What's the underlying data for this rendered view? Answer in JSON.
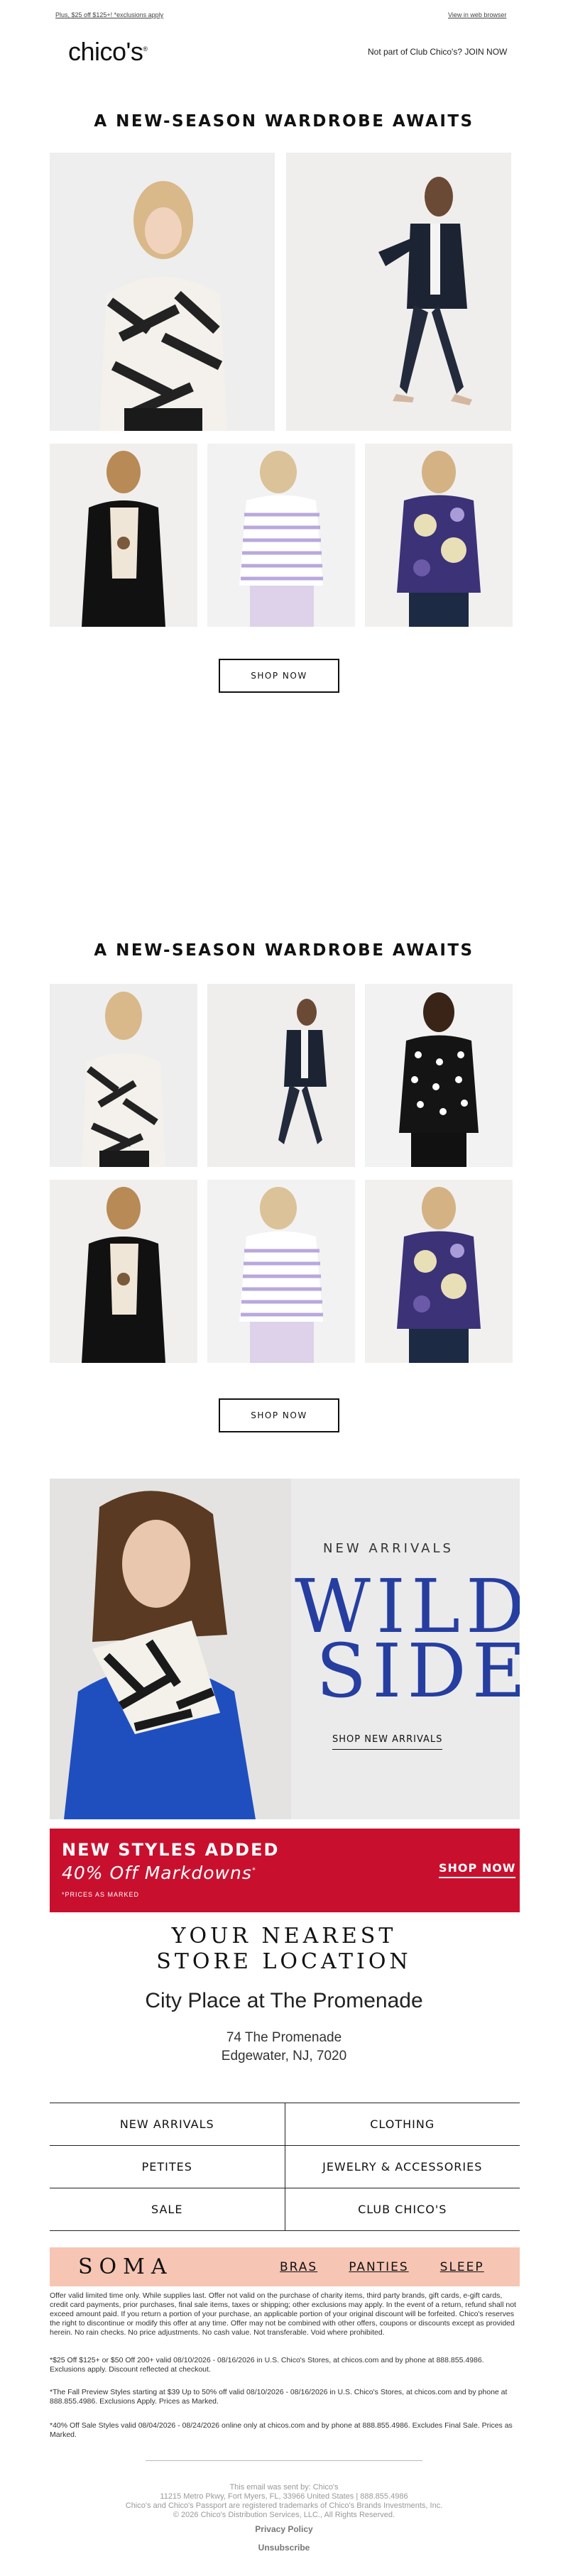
{
  "preheader": {
    "promo_link": "Plus, $25 off $125+! *exclusions apply",
    "web_link": "View in web browser"
  },
  "header": {
    "logo": "chico's",
    "join_text": "Not part of Club Chico's? JOIN NOW"
  },
  "section1": {
    "title": "A NEW-SEASON WARDROBE AWAITS",
    "button": "SHOP NOW"
  },
  "section2": {
    "title": "A NEW-SEASON WARDROBE AWAITS",
    "button": "SHOP NOW"
  },
  "wild_banner": {
    "subtitle": "NEW ARRIVALS",
    "line1": "WILD",
    "line2": "SIDE",
    "cta": "SHOP NEW ARRIVALS"
  },
  "markdown_banner": {
    "line1": "NEW STYLES ADDED",
    "line2": "40% Off Markdowns",
    "line2_mark": "*",
    "note": "*PRICES AS MARKED",
    "cta": "SHOP NOW"
  },
  "store": {
    "title_line1": "YOUR NEAREST",
    "title_line2": "STORE LOCATION",
    "name": "City Place at The Promenade",
    "address_line1": "74 The Promenade",
    "address_line2": "Edgewater, NJ, 7020"
  },
  "nav": {
    "rows": [
      {
        "left": "NEW ARRIVALS",
        "right": "CLOTHING"
      },
      {
        "left": "PETITES",
        "right": "JEWELRY & ACCESSORIES"
      },
      {
        "left": "SALE",
        "right": "CLUB CHICO'S"
      }
    ]
  },
  "soma": {
    "logo": "SOMA",
    "links": [
      "BRAS",
      "PANTIES",
      "SLEEP"
    ]
  },
  "legal": [
    "Offer valid limited time only. While supplies last. Offer not valid on the purchase of charity items, third party brands, gift cards, e-gift cards, credit card payments, prior purchases, final sale items, taxes or shipping; other exclusions may apply. In the event of a return, refund shall not exceed amount paid. If you return a portion of your purchase, an applicable portion of your original discount will be forfeited. Chico's reserves the right to discontinue or modify this offer at any time. Offer may not be combined with other offers, coupons or discounts except as provided herein. No rain checks. No price adjustments. No cash value. Not transferable. Void where prohibited.",
    "*$25 Off $125+ or $50 Off 200+ valid 08/10/2026 - 08/16/2026 in U.S. Chico's Stores, at chicos.com and by phone at 888.855.4986. Exclusions apply. Discount reflected at checkout.",
    "*The Fall Preview Styles starting at $39 Up to 50% off valid 08/10/2026 - 08/16/2026 in U.S. Chico's Stores, at chicos.com and by phone at 888.855.4986. Exclusions Apply. Prices as Marked.",
    "*40% Off Sale Styles valid 08/04/2026 - 08/24/2026 online only at chicos.com and by phone at 888.855.4986. Excludes Final Sale. Prices as Marked."
  ],
  "footer": {
    "sent_by": "This email was sent by: Chico's",
    "address": "11215 Metro Pkwy, Fort Myers, FL, 33966 United States | 888.855.4986",
    "trademark": "Chico's and Chico's Passport are registered trademarks of Chico's Brands Investments, Inc.",
    "copyright": "© 2026 Chico's Distribution Services, LLC., All Rights Reserved.",
    "privacy": "Privacy Policy",
    "unsubscribe": "Unsubscribe"
  },
  "colors": {
    "accent_red": "#c8102e",
    "wild_blue": "#263ea0",
    "soma_bg": "#f7c5b4"
  }
}
